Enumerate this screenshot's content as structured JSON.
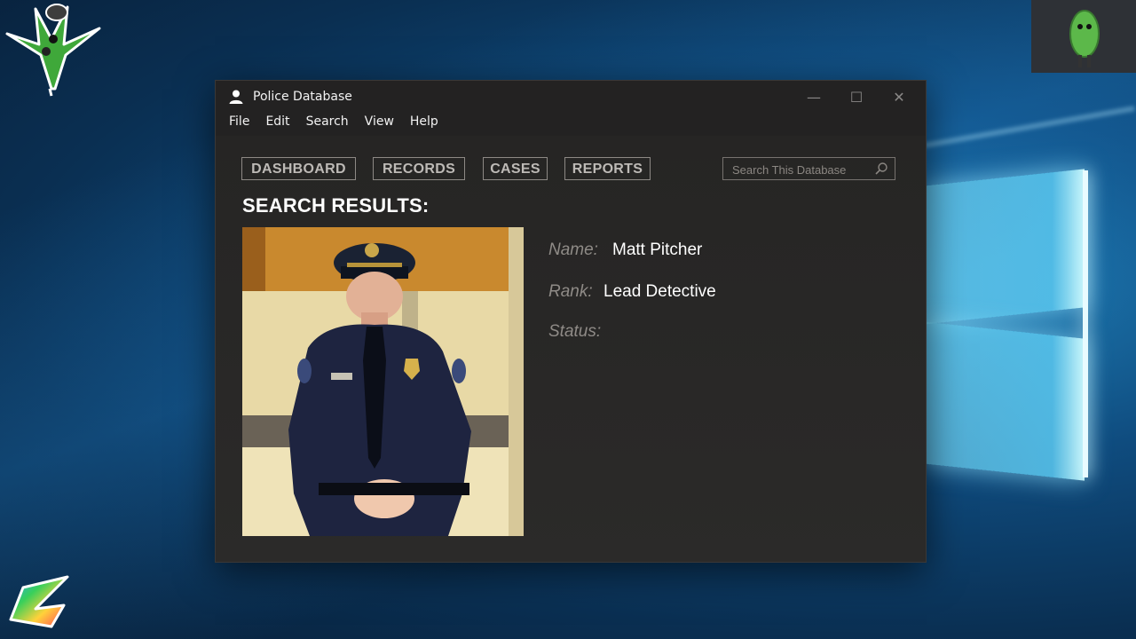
{
  "window": {
    "title": "Police Database",
    "title_icon": "user-icon",
    "controls": {
      "minimize_symbol": "—",
      "maximize_symbol": "☐",
      "close_symbol": "✕"
    }
  },
  "menu": {
    "items": [
      "File",
      "Edit",
      "Search",
      "View",
      "Help"
    ]
  },
  "nav": {
    "dashboard": "DASHBOARD",
    "records": "RECORDS",
    "cases": "CASES",
    "reports": "REPORTS"
  },
  "search": {
    "placeholder": "Search This Database",
    "icon": "search-icon"
  },
  "results": {
    "heading": "SEARCH RESULTS:",
    "photo": "officer-photo",
    "fields": {
      "name_label": "Name:",
      "name_value": "Matt Pitcher",
      "rank_label": "Rank:",
      "rank_value": "Lead Detective",
      "status_label": "Status:"
    }
  },
  "colors": {
    "window_bg": "#232222",
    "nav_border": "#8d8985",
    "label_text": "#8f8b87",
    "value_text": "#ffffff",
    "desktop_bg": "#0f4c7f"
  }
}
